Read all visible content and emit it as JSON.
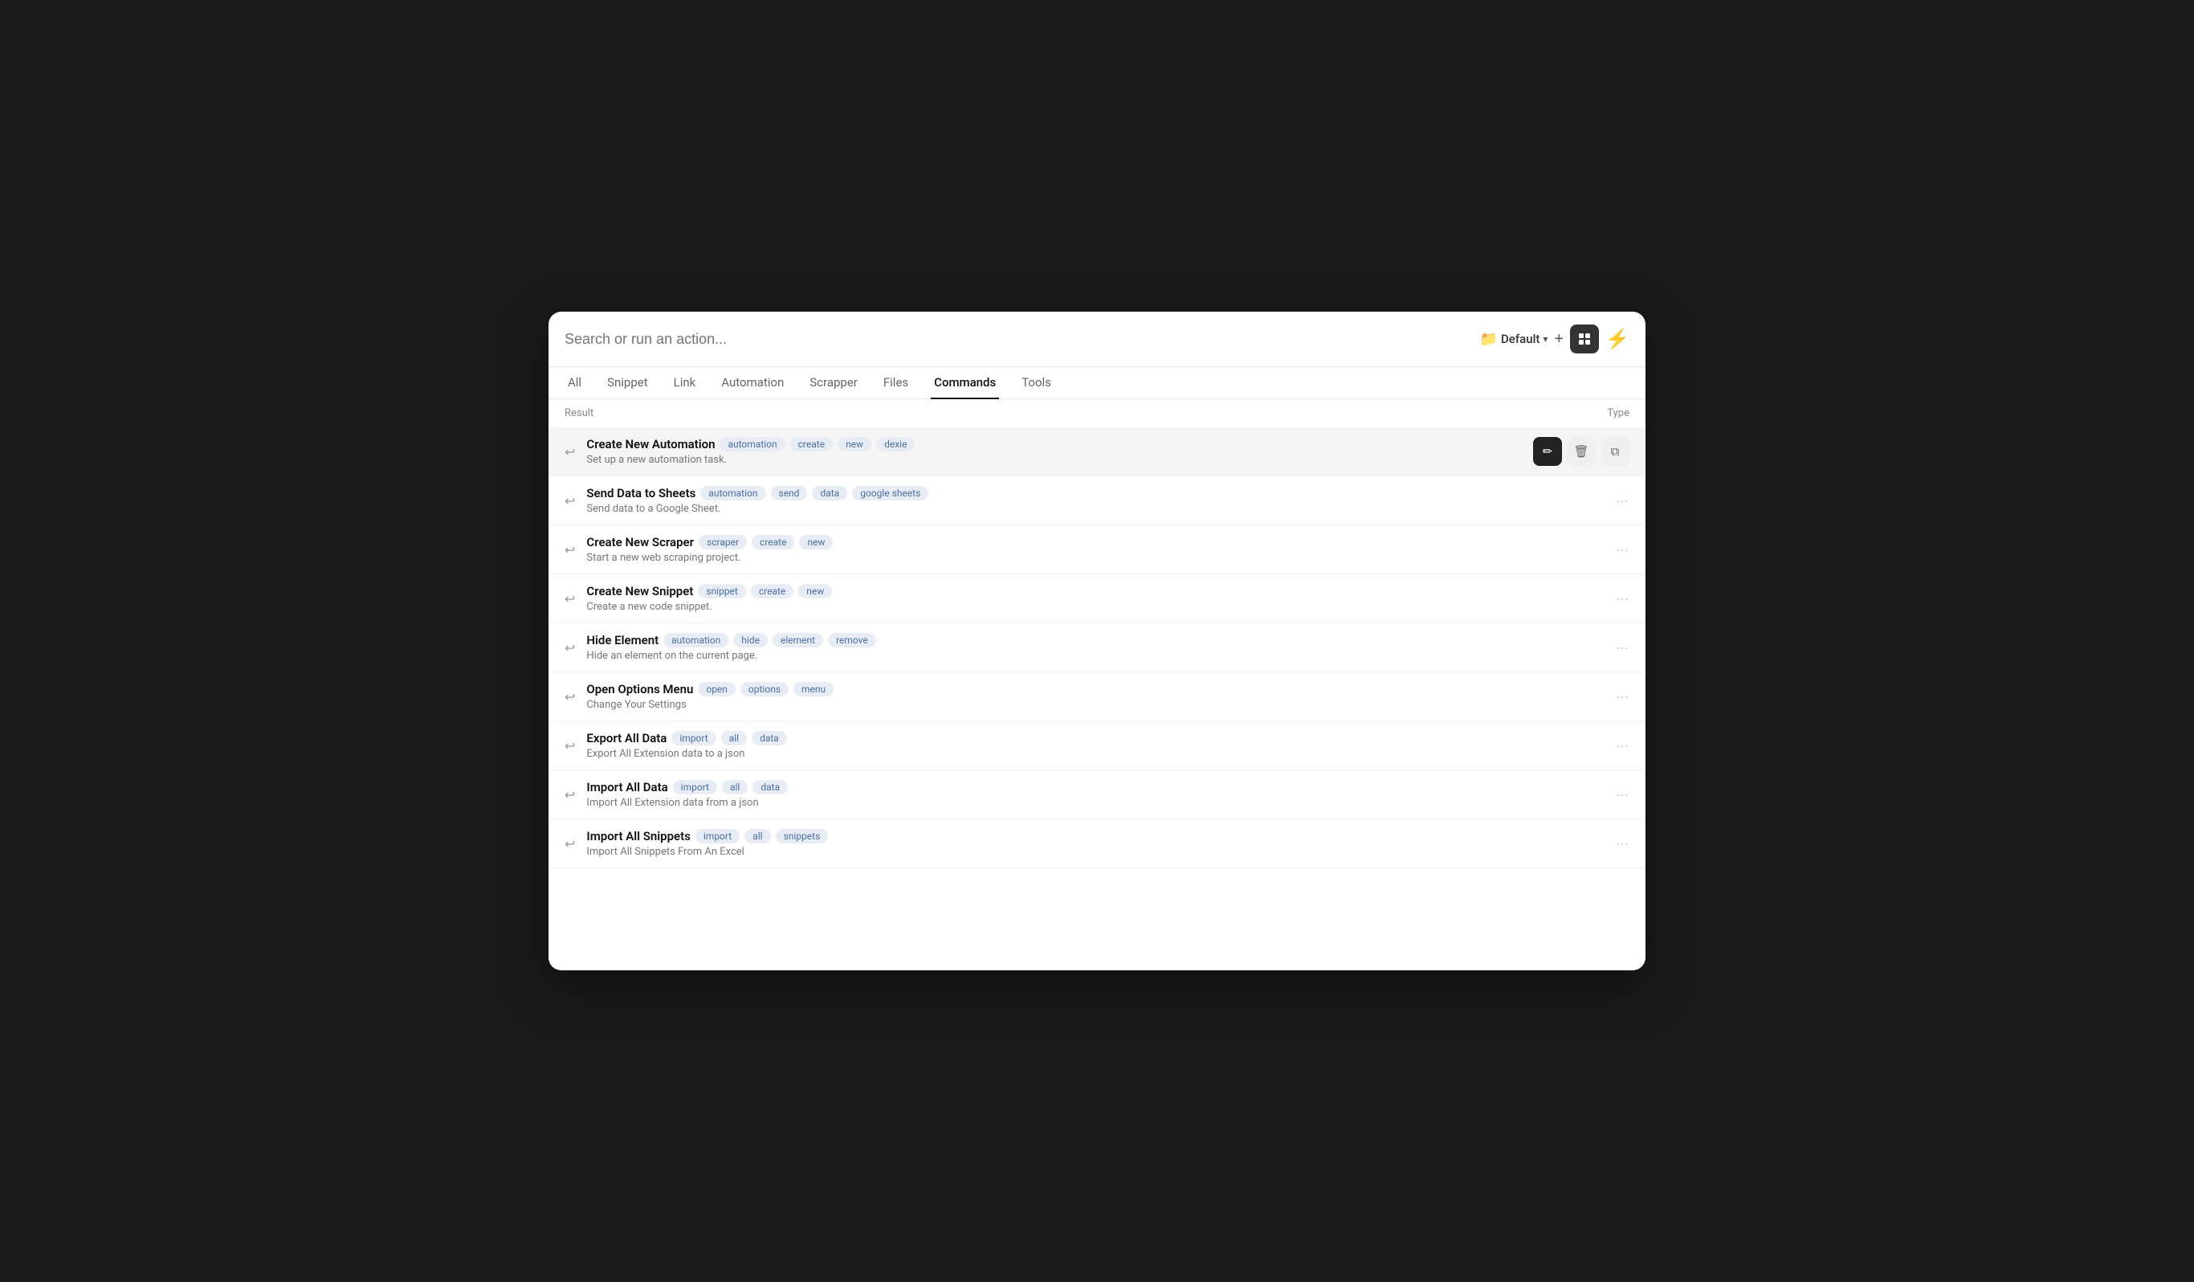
{
  "header": {
    "search_placeholder": "Search or run an action...",
    "workspace_label": "Default",
    "add_label": "+",
    "lightning_icon": "⚡"
  },
  "tabs": [
    {
      "id": "all",
      "label": "All",
      "active": false
    },
    {
      "id": "snippet",
      "label": "Snippet",
      "active": false
    },
    {
      "id": "link",
      "label": "Link",
      "active": false
    },
    {
      "id": "automation",
      "label": "Automation",
      "active": false
    },
    {
      "id": "scrapper",
      "label": "Scrapper",
      "active": false
    },
    {
      "id": "files",
      "label": "Files",
      "active": false
    },
    {
      "id": "commands",
      "label": "Commands",
      "active": true
    },
    {
      "id": "tools",
      "label": "Tools",
      "active": false
    }
  ],
  "table": {
    "result_col": "Result",
    "type_col": "Type"
  },
  "commands": [
    {
      "name": "Create New Automation",
      "tags": [
        "automation",
        "create",
        "new",
        "dexie"
      ],
      "desc": "Set up a new automation task.",
      "active": true,
      "actions": {
        "edit": "✏",
        "delete": "🗑",
        "copy": "⧉"
      }
    },
    {
      "name": "Send Data to Sheets",
      "tags": [
        "automation",
        "send",
        "data",
        "google sheets"
      ],
      "desc": "Send data to a Google Sheet.",
      "active": false
    },
    {
      "name": "Create New Scraper",
      "tags": [
        "scraper",
        "create",
        "new"
      ],
      "desc": "Start a new web scraping project.",
      "active": false
    },
    {
      "name": "Create New Snippet",
      "tags": [
        "snippet",
        "create",
        "new"
      ],
      "desc": "Create a new code snippet.",
      "active": false
    },
    {
      "name": "Hide Element",
      "tags": [
        "automation",
        "hide",
        "element",
        "remove"
      ],
      "desc": "Hide an element on the current page.",
      "active": false
    },
    {
      "name": "Open Options Menu",
      "tags": [
        "open",
        "options",
        "menu"
      ],
      "desc": "Change Your Settings",
      "active": false
    },
    {
      "name": "Export All Data",
      "tags": [
        "import",
        "all",
        "data"
      ],
      "desc": "Export All Extension data to a json",
      "active": false
    },
    {
      "name": "Import All Data",
      "tags": [
        "import",
        "all",
        "data"
      ],
      "desc": "Import All Extension data from a json",
      "active": false
    },
    {
      "name": "Import All Snippets",
      "tags": [
        "import",
        "all",
        "snippets"
      ],
      "desc": "Import All Snippets From An Excel",
      "active": false
    }
  ],
  "actions": {
    "edit_icon": "✏",
    "delete_icon": "🗑",
    "copy_icon": "⧉"
  }
}
